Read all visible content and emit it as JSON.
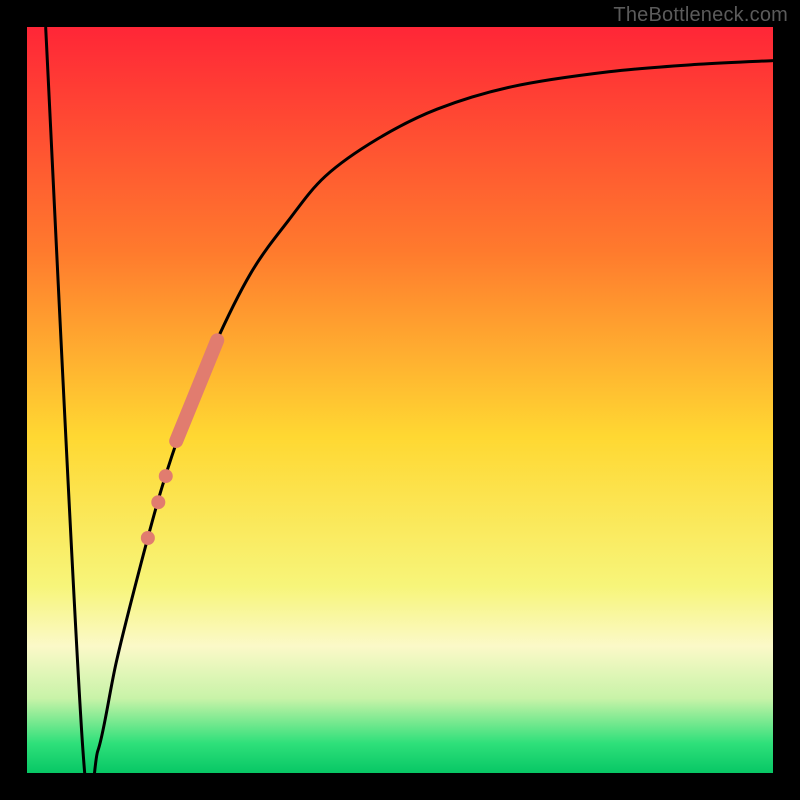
{
  "watermark": "TheBottleneck.com",
  "chart_data": {
    "type": "line",
    "title": "",
    "xlabel": "",
    "ylabel": "",
    "xlim": [
      0,
      100
    ],
    "ylim": [
      0,
      100
    ],
    "gradient_stops": [
      {
        "offset": 0,
        "color": "#ff2637"
      },
      {
        "offset": 30,
        "color": "#ff7a2d"
      },
      {
        "offset": 55,
        "color": "#ffd832"
      },
      {
        "offset": 75,
        "color": "#f7f57a"
      },
      {
        "offset": 83,
        "color": "#fbf9c8"
      },
      {
        "offset": 90,
        "color": "#c8f3a8"
      },
      {
        "offset": 96,
        "color": "#2fe07a"
      },
      {
        "offset": 100,
        "color": "#07c765"
      }
    ],
    "series": [
      {
        "name": "bottleneck-curve",
        "color": "#000000",
        "stroke_width": 3,
        "points": [
          {
            "x": 2.5,
            "y": 100
          },
          {
            "x": 7.5,
            "y": 3
          },
          {
            "x": 9.5,
            "y": 3
          },
          {
            "x": 12,
            "y": 15
          },
          {
            "x": 15,
            "y": 27
          },
          {
            "x": 18,
            "y": 38
          },
          {
            "x": 21,
            "y": 47
          },
          {
            "x": 25,
            "y": 57
          },
          {
            "x": 30,
            "y": 67
          },
          {
            "x": 35,
            "y": 74
          },
          {
            "x": 40,
            "y": 80
          },
          {
            "x": 47,
            "y": 85
          },
          {
            "x": 55,
            "y": 89
          },
          {
            "x": 65,
            "y": 92
          },
          {
            "x": 78,
            "y": 94
          },
          {
            "x": 90,
            "y": 95
          },
          {
            "x": 100,
            "y": 95.5
          }
        ]
      }
    ],
    "overlay_segment": {
      "name": "highlight-thick",
      "color": "#e17c6f",
      "stroke_width": 14,
      "linecap": "round",
      "points": [
        {
          "x": 20.0,
          "y": 44.5
        },
        {
          "x": 25.5,
          "y": 58.0
        }
      ]
    },
    "overlay_dots": {
      "name": "highlight-dots",
      "color": "#e17c6f",
      "radius": 7,
      "points": [
        {
          "x": 18.6,
          "y": 39.8
        },
        {
          "x": 17.6,
          "y": 36.3
        },
        {
          "x": 16.2,
          "y": 31.5
        }
      ]
    }
  }
}
